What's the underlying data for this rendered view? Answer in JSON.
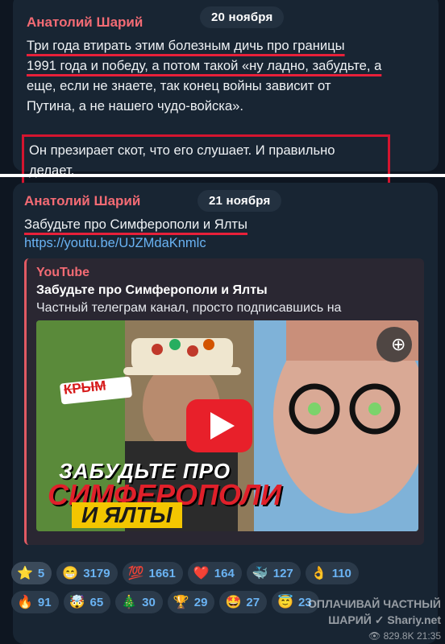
{
  "message1": {
    "date": "20 ноября",
    "sender": "Анатолий Шарий",
    "line1": "Три года втирать этим болезным дичь про границы",
    "line2": "1991 года и победу, а потом такой «ну ладно, забудьте, а",
    "line3": "еще, если не знаете,  так конец войны зависит от",
    "line4": "Путина, а не нашего чудо-войска».",
    "boxed_text": "Он презирает скот, что его слушает. И правильно делает."
  },
  "message2": {
    "date": "21 ноября",
    "sender": "Анатолий Шарий",
    "text": "Забудьте про Симферополи и Ялты",
    "link": "https://youtu.be/UJZMdaKnmlc",
    "preview": {
      "site": "YouTube",
      "title": "Забудьте про Симферополи и Ялты",
      "description": "Частный телеграм канал, просто подписавшись на",
      "thumb": {
        "badge": "КРЫМ",
        "line1": "ЗАБУДЬТЕ ПРО",
        "line2": "СИМФЕРОПОЛИ",
        "line3": "И ЯЛТЫ"
      }
    }
  },
  "reactions_row1": [
    {
      "emoji": "⭐",
      "icon": "star-icon",
      "count": "5"
    },
    {
      "emoji": "😁",
      "icon": "grin-icon",
      "count": "3179"
    },
    {
      "emoji": "💯",
      "icon": "hundred-icon",
      "count": "1661"
    },
    {
      "emoji": "❤️",
      "icon": "heart-icon",
      "count": "164"
    },
    {
      "emoji": "🐳",
      "icon": "whale-icon",
      "count": "127"
    },
    {
      "emoji": "👌",
      "icon": "ok-hand-icon",
      "count": "110"
    }
  ],
  "reactions_row2": [
    {
      "emoji": "🔥",
      "icon": "fire-icon",
      "count": "91"
    },
    {
      "emoji": "🤯",
      "icon": "mind-blown-icon",
      "count": "65"
    },
    {
      "emoji": "🎄",
      "icon": "tree-icon",
      "count": "30"
    },
    {
      "emoji": "🏆",
      "icon": "trophy-icon",
      "count": "29"
    },
    {
      "emoji": "🤩",
      "icon": "star-struck-icon",
      "count": "27"
    },
    {
      "emoji": "😇",
      "icon": "angel-icon",
      "count": "23"
    }
  ],
  "watermark": {
    "line1": "ОПЛАЧИВАЙ ЧАСТНЫЙ",
    "line2": "ШАРИЙ ✓ Shariy.net",
    "views": "829.8K",
    "time": "21:35"
  },
  "colors": {
    "sender": "#f36b74",
    "link": "#6ab3f3",
    "highlight": "#e8203a"
  }
}
